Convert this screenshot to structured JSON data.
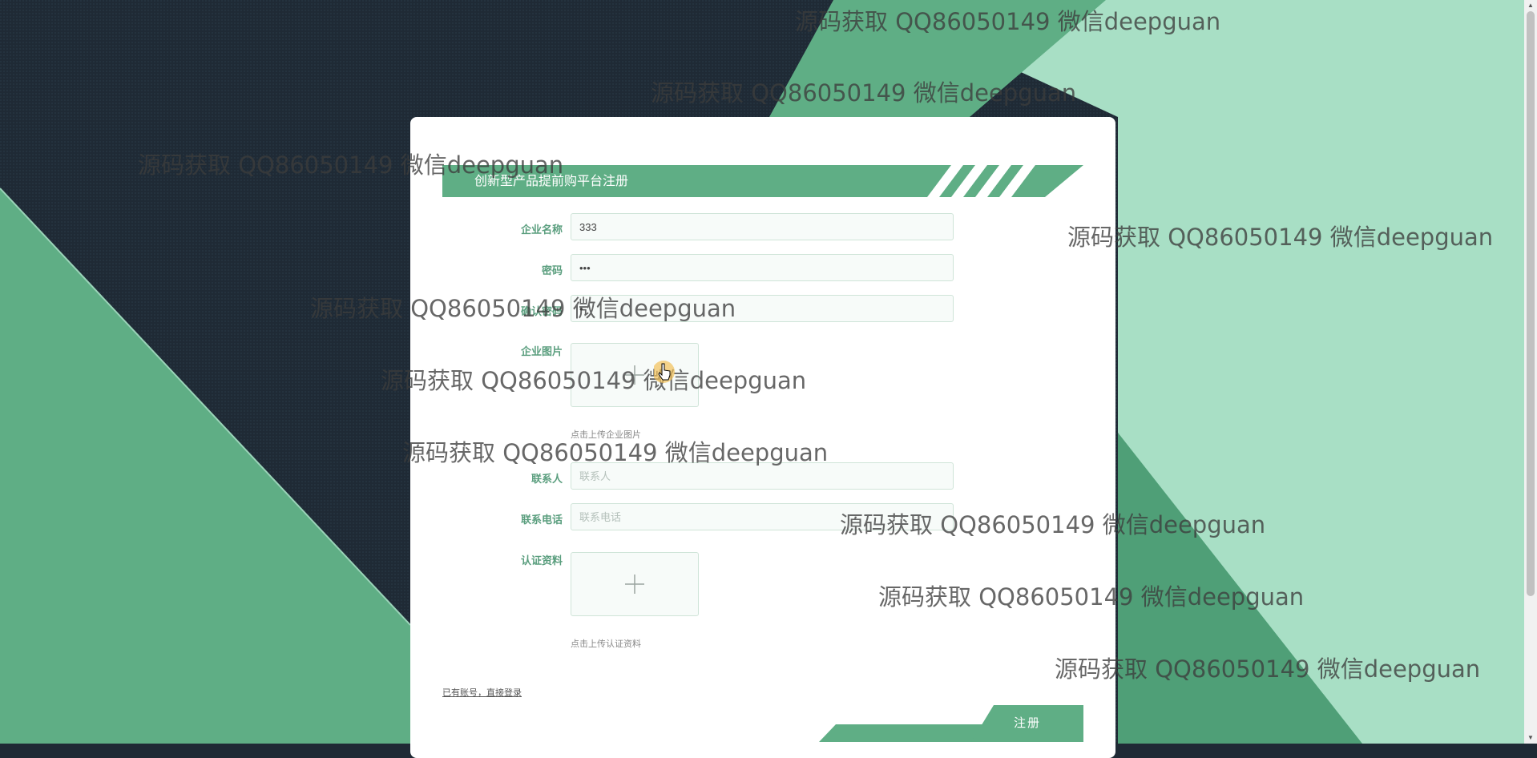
{
  "form": {
    "title": "创新型产品提前购平台注册",
    "fields": [
      {
        "label": "企业名称",
        "value": "333",
        "placeholder": ""
      },
      {
        "label": "密码",
        "value": "•••",
        "placeholder": ""
      },
      {
        "label": "确认密码",
        "value": "•",
        "placeholder": ""
      },
      {
        "label": "联系人",
        "value": "",
        "placeholder": "联系人"
      },
      {
        "label": "联系电话",
        "value": "",
        "placeholder": "联系电话"
      }
    ],
    "uploads": [
      {
        "label": "企业图片",
        "hint": "点击上传企业图片"
      },
      {
        "label": "认证资料",
        "hint": "点击上传认证资料"
      }
    ],
    "login_link": "已有账号，直接登录",
    "register_button": "注册"
  },
  "watermark": "源码获取 QQ86050149 微信deepguan",
  "colors": {
    "accent": "#5fae85",
    "dark_bg": "#1f2a35",
    "light_green": "#a8dfc5",
    "mid_green": "#5fae85"
  },
  "icons": [
    "plus-icon",
    "hand-cursor-icon"
  ]
}
